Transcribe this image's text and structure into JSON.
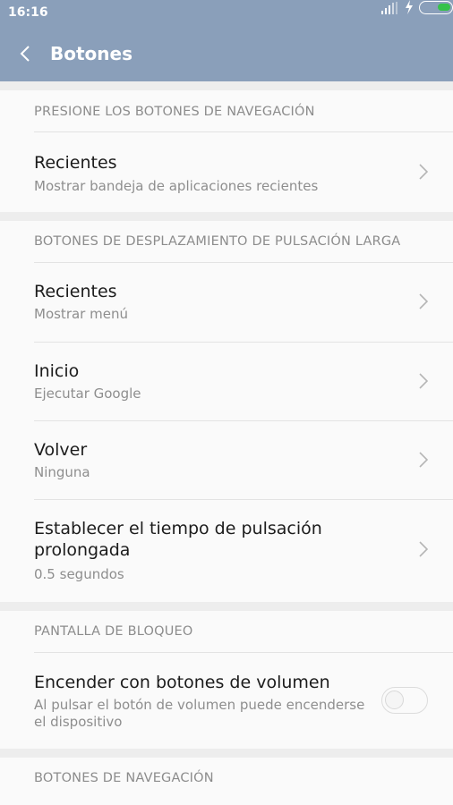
{
  "status": {
    "time": "16:16"
  },
  "appbar": {
    "title": "Botones"
  },
  "sections": {
    "nav_press": {
      "header": "PRESIONE LOS BOTONES DE NAVEGACIÓN",
      "items": [
        {
          "title": "Recientes",
          "subtitle": "Mostrar bandeja de aplicaciones recientes"
        }
      ]
    },
    "long_press": {
      "header": "BOTONES DE DESPLAZAMIENTO DE PULSACIÓN LARGA",
      "items": [
        {
          "title": "Recientes",
          "subtitle": "Mostrar menú"
        },
        {
          "title": "Inicio",
          "subtitle": "Ejecutar Google"
        },
        {
          "title": "Volver",
          "subtitle": "Ninguna"
        },
        {
          "title_line1": "Establecer el tiempo de pulsación",
          "title_line2": "prolongada",
          "subtitle": "0.5 segundos"
        }
      ]
    },
    "lock_screen": {
      "header": "PANTALLA DE BLOQUEO",
      "items": [
        {
          "title": "Encender con botones de volumen",
          "subtitle_line1": "Al pulsar el botón de volumen puede encenderse",
          "subtitle_line2": "el dispositivo",
          "toggle_on": false
        }
      ]
    },
    "nav_buttons": {
      "header": "BOTONES DE NAVEGACIÓN"
    }
  },
  "colors": {
    "appbar": "#8a9fba",
    "background": "#ededed",
    "card": "#fafafa",
    "battery": "#36c24a"
  }
}
